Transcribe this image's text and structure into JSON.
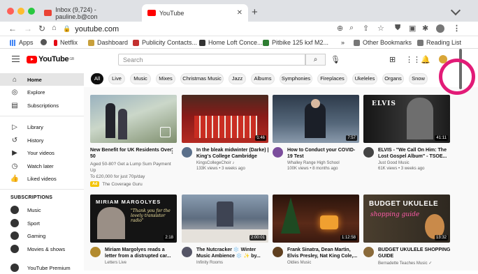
{
  "browser": {
    "tabs": [
      {
        "title": "Inbox (9,724) - pauline.b@con",
        "active": false
      },
      {
        "title": "YouTube",
        "active": true
      }
    ],
    "url": "youtube.com",
    "bookmarks": [
      "Apps",
      "Netflix",
      "Dashboard",
      "Publicity Contacts...",
      "Home Loft Conce...",
      "Pitbike 125 kxf M2...",
      "»",
      "Other Bookmarks",
      "Reading List"
    ]
  },
  "youtube": {
    "logo": "YouTube",
    "region": "GB",
    "search_placeholder": "Search",
    "chips": [
      "All",
      "Live",
      "Music",
      "Mixes",
      "Christmas Music",
      "Jazz",
      "Albums",
      "Symphonies",
      "Fireplaces",
      "Ukeleles",
      "Organs",
      "Snow"
    ],
    "sidebar": {
      "main": [
        {
          "label": "Home",
          "icon": "home-icon"
        },
        {
          "label": "Explore",
          "icon": "compass-icon"
        },
        {
          "label": "Subscriptions",
          "icon": "subscriptions-icon"
        }
      ],
      "library": [
        {
          "label": "Library",
          "icon": "library-icon"
        },
        {
          "label": "History",
          "icon": "history-icon"
        },
        {
          "label": "Your videos",
          "icon": "your-videos-icon"
        },
        {
          "label": "Watch later",
          "icon": "clock-icon"
        },
        {
          "label": "Liked videos",
          "icon": "thumbs-up-icon"
        }
      ],
      "subscriptions_heading": "SUBSCRIPTIONS",
      "subscriptions": [
        "Music",
        "Sport",
        "Gaming",
        "Movies & shows",
        "YouTube Premium"
      ]
    },
    "ad": {
      "title": "New Benefit for UK Residents Over 50",
      "desc1": "Aged 50-80? Get a Lump Sum Payment Up",
      "desc2": "To £20,000 for just 70p/day",
      "badge": "Ad",
      "advertiser": "The Coverage Guru"
    },
    "videos": [
      {
        "title": "In the bleak midwinter (Darke) | King's College Cambridge",
        "channel": "KingsCollegeChoir ♪",
        "stats": "133K views • 3 weeks ago",
        "duration": "1:46",
        "thumb": "#7a1010",
        "avatar": "#5a6f8a"
      },
      {
        "title": "How to Conduct your COVID-19 Test",
        "channel": "Whalley Range High School",
        "stats": "100K views • 8 months ago",
        "duration": "7:57",
        "thumb": "#3a4a5a",
        "avatar": "#7b4d9c"
      },
      {
        "title": "ELVIS - \"We Call On Him: The Lost Gospel Album\" - TSOE...",
        "channel": "Just Good Music",
        "stats": "61K views • 3 weeks ago",
        "duration": "41:11",
        "thumb": "#1e1e1e",
        "avatar": "#444"
      },
      {
        "title": "Miriam Margolyes reads a letter from a distrupted car...",
        "channel": "Letters Live",
        "stats": "",
        "duration": "2:18",
        "thumb": "#141414",
        "avatar": "#b28a2e"
      },
      {
        "title": "The Nutcracker ❄️ Winter Music Ambience ❄️ ✨ by...",
        "channel": "Infinity Rooms",
        "stats": "",
        "duration": "2:00:01",
        "thumb": "#6c7a8e",
        "avatar": "#556"
      },
      {
        "title": "Frank Sinatra, Dean Martin, Elvis Presley, Nat King Cole,...",
        "channel": "Oldies Music",
        "stats": "",
        "duration": "1:12:58",
        "thumb": "#3a1a10",
        "avatar": "#604020"
      },
      {
        "title": "BUDGET UKULELE SHOPPING GUIDE",
        "channel": "Bernadette Teaches Music ✓",
        "stats": "",
        "duration": "13:32",
        "thumb": "#2e2820",
        "avatar": "#8a6a3a"
      }
    ]
  }
}
